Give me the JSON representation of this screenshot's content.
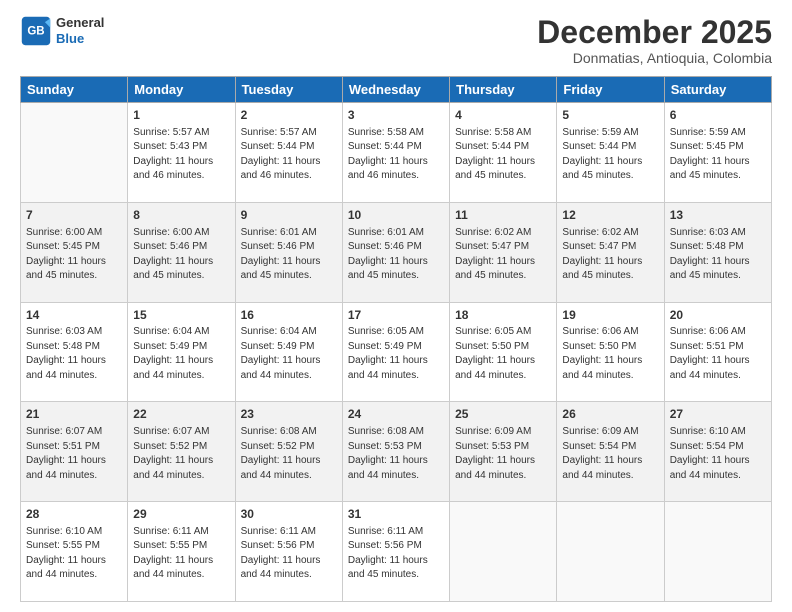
{
  "header": {
    "logo_line1": "General",
    "logo_line2": "Blue",
    "month_title": "December 2025",
    "location": "Donmatias, Antioquia, Colombia"
  },
  "days_of_week": [
    "Sunday",
    "Monday",
    "Tuesday",
    "Wednesday",
    "Thursday",
    "Friday",
    "Saturday"
  ],
  "weeks": [
    [
      {
        "day": "",
        "info": ""
      },
      {
        "day": "1",
        "info": "Sunrise: 5:57 AM\nSunset: 5:43 PM\nDaylight: 11 hours\nand 46 minutes."
      },
      {
        "day": "2",
        "info": "Sunrise: 5:57 AM\nSunset: 5:44 PM\nDaylight: 11 hours\nand 46 minutes."
      },
      {
        "day": "3",
        "info": "Sunrise: 5:58 AM\nSunset: 5:44 PM\nDaylight: 11 hours\nand 46 minutes."
      },
      {
        "day": "4",
        "info": "Sunrise: 5:58 AM\nSunset: 5:44 PM\nDaylight: 11 hours\nand 45 minutes."
      },
      {
        "day": "5",
        "info": "Sunrise: 5:59 AM\nSunset: 5:44 PM\nDaylight: 11 hours\nand 45 minutes."
      },
      {
        "day": "6",
        "info": "Sunrise: 5:59 AM\nSunset: 5:45 PM\nDaylight: 11 hours\nand 45 minutes."
      }
    ],
    [
      {
        "day": "7",
        "info": "Sunrise: 6:00 AM\nSunset: 5:45 PM\nDaylight: 11 hours\nand 45 minutes."
      },
      {
        "day": "8",
        "info": "Sunrise: 6:00 AM\nSunset: 5:46 PM\nDaylight: 11 hours\nand 45 minutes."
      },
      {
        "day": "9",
        "info": "Sunrise: 6:01 AM\nSunset: 5:46 PM\nDaylight: 11 hours\nand 45 minutes."
      },
      {
        "day": "10",
        "info": "Sunrise: 6:01 AM\nSunset: 5:46 PM\nDaylight: 11 hours\nand 45 minutes."
      },
      {
        "day": "11",
        "info": "Sunrise: 6:02 AM\nSunset: 5:47 PM\nDaylight: 11 hours\nand 45 minutes."
      },
      {
        "day": "12",
        "info": "Sunrise: 6:02 AM\nSunset: 5:47 PM\nDaylight: 11 hours\nand 45 minutes."
      },
      {
        "day": "13",
        "info": "Sunrise: 6:03 AM\nSunset: 5:48 PM\nDaylight: 11 hours\nand 45 minutes."
      }
    ],
    [
      {
        "day": "14",
        "info": "Sunrise: 6:03 AM\nSunset: 5:48 PM\nDaylight: 11 hours\nand 44 minutes."
      },
      {
        "day": "15",
        "info": "Sunrise: 6:04 AM\nSunset: 5:49 PM\nDaylight: 11 hours\nand 44 minutes."
      },
      {
        "day": "16",
        "info": "Sunrise: 6:04 AM\nSunset: 5:49 PM\nDaylight: 11 hours\nand 44 minutes."
      },
      {
        "day": "17",
        "info": "Sunrise: 6:05 AM\nSunset: 5:49 PM\nDaylight: 11 hours\nand 44 minutes."
      },
      {
        "day": "18",
        "info": "Sunrise: 6:05 AM\nSunset: 5:50 PM\nDaylight: 11 hours\nand 44 minutes."
      },
      {
        "day": "19",
        "info": "Sunrise: 6:06 AM\nSunset: 5:50 PM\nDaylight: 11 hours\nand 44 minutes."
      },
      {
        "day": "20",
        "info": "Sunrise: 6:06 AM\nSunset: 5:51 PM\nDaylight: 11 hours\nand 44 minutes."
      }
    ],
    [
      {
        "day": "21",
        "info": "Sunrise: 6:07 AM\nSunset: 5:51 PM\nDaylight: 11 hours\nand 44 minutes."
      },
      {
        "day": "22",
        "info": "Sunrise: 6:07 AM\nSunset: 5:52 PM\nDaylight: 11 hours\nand 44 minutes."
      },
      {
        "day": "23",
        "info": "Sunrise: 6:08 AM\nSunset: 5:52 PM\nDaylight: 11 hours\nand 44 minutes."
      },
      {
        "day": "24",
        "info": "Sunrise: 6:08 AM\nSunset: 5:53 PM\nDaylight: 11 hours\nand 44 minutes."
      },
      {
        "day": "25",
        "info": "Sunrise: 6:09 AM\nSunset: 5:53 PM\nDaylight: 11 hours\nand 44 minutes."
      },
      {
        "day": "26",
        "info": "Sunrise: 6:09 AM\nSunset: 5:54 PM\nDaylight: 11 hours\nand 44 minutes."
      },
      {
        "day": "27",
        "info": "Sunrise: 6:10 AM\nSunset: 5:54 PM\nDaylight: 11 hours\nand 44 minutes."
      }
    ],
    [
      {
        "day": "28",
        "info": "Sunrise: 6:10 AM\nSunset: 5:55 PM\nDaylight: 11 hours\nand 44 minutes."
      },
      {
        "day": "29",
        "info": "Sunrise: 6:11 AM\nSunset: 5:55 PM\nDaylight: 11 hours\nand 44 minutes."
      },
      {
        "day": "30",
        "info": "Sunrise: 6:11 AM\nSunset: 5:56 PM\nDaylight: 11 hours\nand 44 minutes."
      },
      {
        "day": "31",
        "info": "Sunrise: 6:11 AM\nSunset: 5:56 PM\nDaylight: 11 hours\nand 45 minutes."
      },
      {
        "day": "",
        "info": ""
      },
      {
        "day": "",
        "info": ""
      },
      {
        "day": "",
        "info": ""
      }
    ]
  ]
}
